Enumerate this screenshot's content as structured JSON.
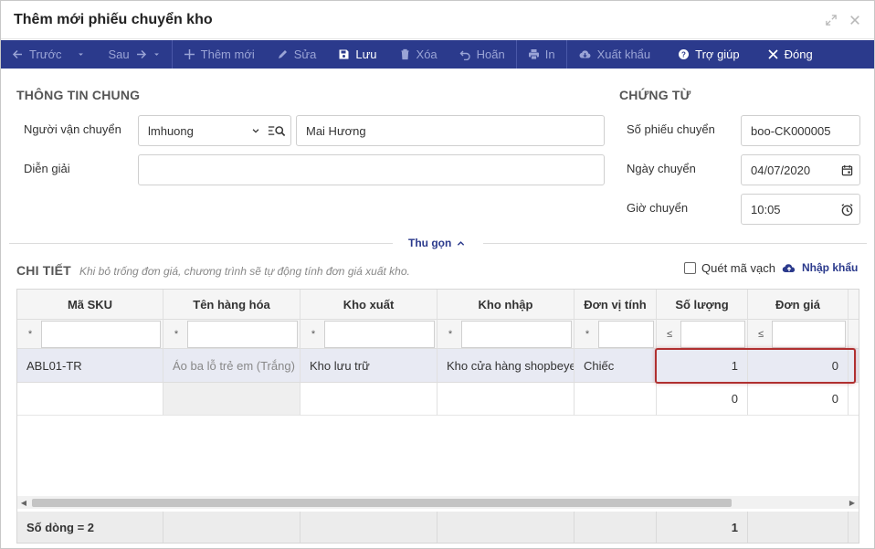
{
  "dialog": {
    "title": "Thêm mới phiếu chuyển kho"
  },
  "toolbar": {
    "prev": "Trước",
    "next": "Sau",
    "add": "Thêm mới",
    "edit": "Sửa",
    "save": "Lưu",
    "delete": "Xóa",
    "undo": "Hoãn",
    "print": "In",
    "export": "Xuất khẩu",
    "help": "Trợ giúp",
    "close": "Đóng"
  },
  "general": {
    "title": "THÔNG TIN CHUNG",
    "carrier_label": "Người vận chuyển",
    "carrier_code": "lmhuong",
    "carrier_name": "Mai Hương",
    "note_label": "Diễn giải",
    "note_value": ""
  },
  "voucher": {
    "title": "CHỨNG TỪ",
    "number_label": "Số phiếu chuyển",
    "number_value": "boo-CK000005",
    "date_label": "Ngày chuyển",
    "date_value": "04/07/2020",
    "time_label": "Giờ chuyển",
    "time_value": "10:05"
  },
  "collapse_label": "Thu gọn",
  "detail": {
    "title": "CHI TIẾT",
    "hint": "Khi bỏ trống đơn giá, chương trình sẽ tự động tính đơn giá xuất kho.",
    "barcode_label": "Quét mã vạch",
    "import_label": "Nhập khẩu",
    "columns": [
      "Mã SKU",
      "Tên hàng hóa",
      "Kho xuất",
      "Kho nhập",
      "Đơn vị tính",
      "Số lượng",
      "Đơn giá"
    ],
    "filter_ops": [
      "*",
      "*",
      "*",
      "*",
      "*",
      "≤",
      "≤"
    ],
    "rows": [
      [
        "ABL01-TR",
        "Áo ba lỗ trẻ em (Trắng)",
        "Kho lưu trữ",
        "Kho cửa hàng shopbeyeu",
        "Chiếc",
        "1",
        "0"
      ],
      [
        "",
        "",
        "",
        "",
        "",
        "0",
        "0"
      ]
    ],
    "footer": {
      "row_count": "Số dòng = 2",
      "qty_total": "1"
    }
  }
}
